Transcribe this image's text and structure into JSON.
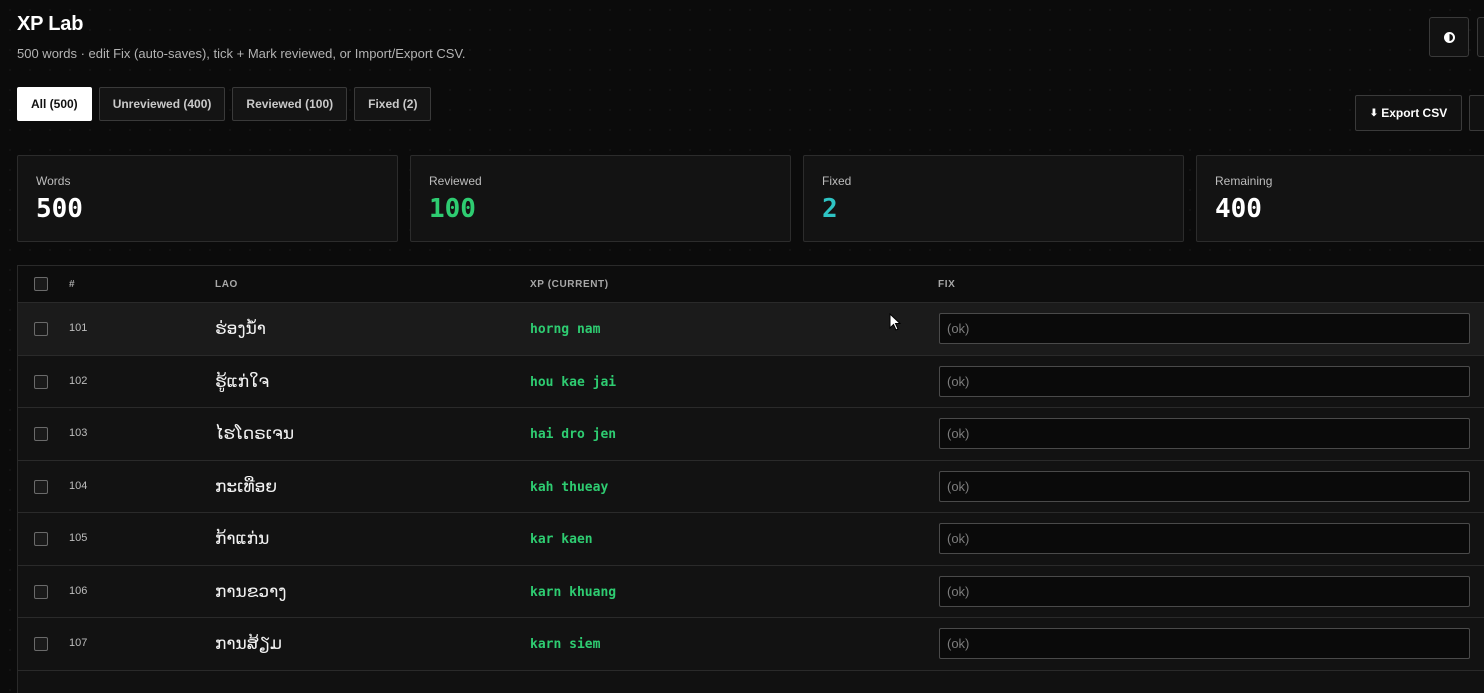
{
  "app": {
    "title": "XP Lab",
    "subtitle": "500 words · edit Fix (auto-saves), tick + Mark reviewed, or Import/Export CSV."
  },
  "icons": {
    "theme_toggle": "contrast-icon",
    "export": "download-arrow-icon"
  },
  "tabs": [
    {
      "label": "All (500)",
      "active": true
    },
    {
      "label": "Unreviewed (400)",
      "active": false
    },
    {
      "label": "Reviewed (100)",
      "active": false
    },
    {
      "label": "Fixed (2)",
      "active": false
    }
  ],
  "toolbar": {
    "export_label": "Export CSV",
    "export_arrow": "⬇"
  },
  "stats": [
    {
      "label": "Words",
      "value": "500",
      "color": "#ffffff"
    },
    {
      "label": "Reviewed",
      "value": "100",
      "color": "#2ecc71"
    },
    {
      "label": "Fixed",
      "value": "2",
      "color": "#2ec4c4"
    },
    {
      "label": "Remaining",
      "value": "400",
      "color": "#ffffff"
    }
  ],
  "table": {
    "headers": {
      "num": "#",
      "lao": "LAO",
      "xp": "XP (CURRENT)",
      "fix": "FIX"
    },
    "rows": [
      {
        "num": "101",
        "lao": "ຮ່ອງນ້ຳ",
        "xp": "horng nam",
        "fix": "",
        "fix_placeholder": "(ok)"
      },
      {
        "num": "102",
        "lao": "ຮູ້ແກ່ໃຈ",
        "xp": "hou kae jai",
        "fix": "",
        "fix_placeholder": "(ok)"
      },
      {
        "num": "103",
        "lao": "ໄຮໂດຣເຈນ",
        "xp": "hai dro jen",
        "fix": "",
        "fix_placeholder": "(ok)"
      },
      {
        "num": "104",
        "lao": "ກະເທືອຍ",
        "xp": "kah thueay",
        "fix": "",
        "fix_placeholder": "(ok)"
      },
      {
        "num": "105",
        "lao": "ກ້າແກ່ນ",
        "xp": "kar kaen",
        "fix": "",
        "fix_placeholder": "(ok)"
      },
      {
        "num": "106",
        "lao": "ການຂວາງ",
        "xp": "karn khuang",
        "fix": "",
        "fix_placeholder": "(ok)"
      },
      {
        "num": "107",
        "lao": "ການສ້ຽມ",
        "xp": "karn siem",
        "fix": "",
        "fix_placeholder": "(ok)"
      }
    ]
  }
}
